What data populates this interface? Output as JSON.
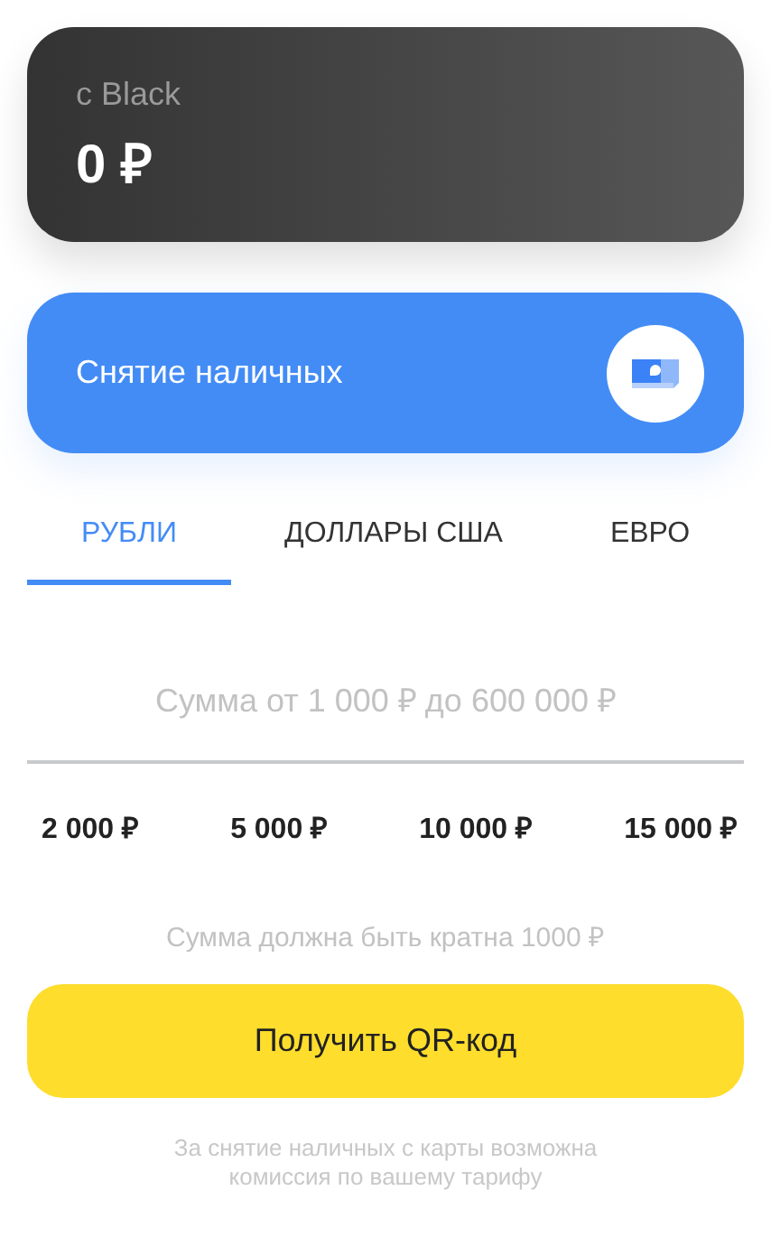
{
  "account": {
    "label": "с Black",
    "balance": "0 ₽"
  },
  "action": {
    "title": "Снятие наличных"
  },
  "tabs": [
    {
      "label": "РУБЛИ",
      "selected": true
    },
    {
      "label": "ДОЛЛАРЫ США",
      "selected": false
    },
    {
      "label": "ЕВРО",
      "selected": false
    }
  ],
  "amount": {
    "placeholder": "Сумма от 1 000 ₽ до 600 000 ₽"
  },
  "presets": [
    "2 000 ₽",
    "5 000 ₽",
    "10 000 ₽",
    "15 000 ₽"
  ],
  "hint": "Сумма должна быть кратна 1000 ₽",
  "button": "Получить QR-код",
  "footnote": "За снятие наличных с карты возможна комиссия по вашему тарифу"
}
